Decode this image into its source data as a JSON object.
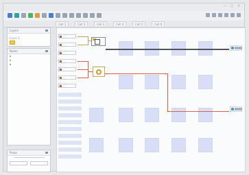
{
  "window": {
    "title": ""
  },
  "tabs": [
    {
      "label": "Cell 1"
    },
    {
      "label": "Cell 2"
    },
    {
      "label": "Cell 3"
    },
    {
      "label": "Cell 4"
    },
    {
      "label": "Cell 5"
    },
    {
      "label": "Cell 6"
    }
  ],
  "left": {
    "panel1": {
      "title": "Layers",
      "item": "Layer 1"
    },
    "panel2": {
      "title": "Notes",
      "l1": "",
      "l2": "",
      "l3": ""
    },
    "panel3": {
      "title": "Props",
      "a": "",
      "b": ""
    }
  },
  "canvas": {
    "row_labels": [
      "",
      "",
      "",
      "",
      "",
      "",
      "",
      ""
    ]
  }
}
